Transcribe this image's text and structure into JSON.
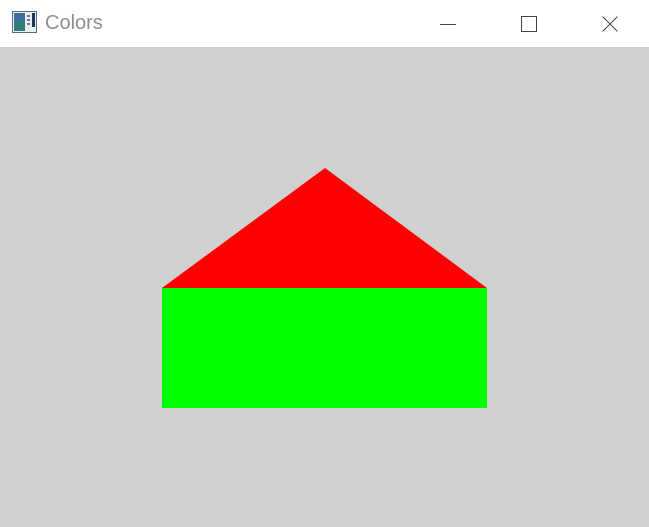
{
  "window": {
    "title": "Colors",
    "app_icon": "window-app-icon",
    "controls": {
      "minimize_icon": "minimize-icon",
      "maximize_icon": "maximize-icon",
      "close_icon": "close-icon"
    }
  },
  "canvas": {
    "background_color": "#d0d0cf",
    "shapes": [
      {
        "name": "roof-triangle",
        "shape": "triangle",
        "color": "#ff0000"
      },
      {
        "name": "house-body-rectangle",
        "shape": "rectangle",
        "color": "#00ff00"
      }
    ]
  }
}
